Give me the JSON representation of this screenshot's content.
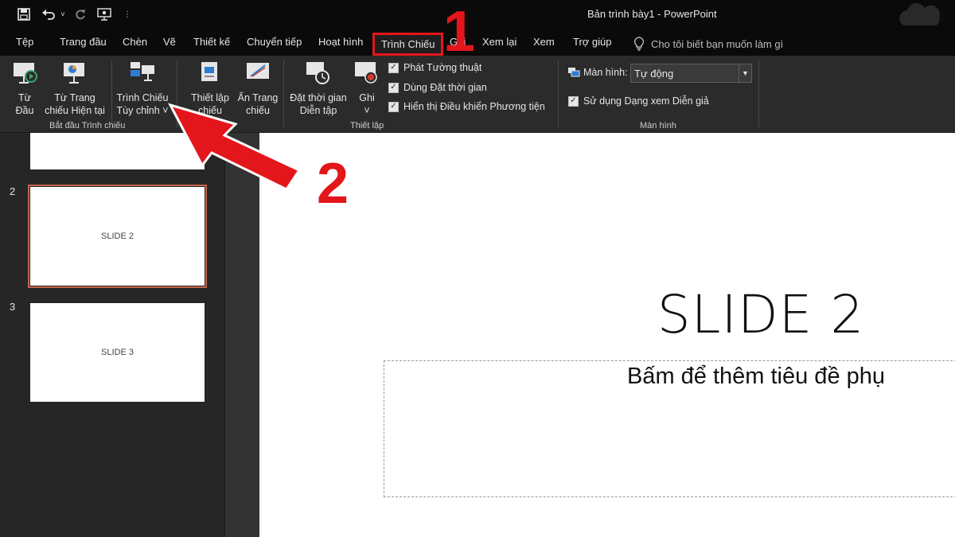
{
  "titlebar": {
    "doc_title": "Bản trình bày1  -  PowerPoint"
  },
  "menu": {
    "tabs": [
      "Tệp",
      "Trang đầu",
      "Chèn",
      "Vẽ",
      "Thiết kế",
      "Chuyển tiếp",
      "Hoạt hình",
      "Trình Chiếu",
      "Ghi",
      "Xem lại",
      "Xem",
      "Trợ giúp"
    ],
    "active_tab": "Trình Chiếu",
    "tell_me": "Cho tôi biết bạn muốn làm gì"
  },
  "ribbon": {
    "start_group": {
      "from_start": [
        "Từ",
        "Đầu"
      ],
      "from_current": [
        "Từ Trang",
        "chiếu Hiện tại"
      ],
      "custom_show": [
        "Trình Chiếu",
        "Tùy chỉnh ˅"
      ],
      "label": "Bắt đầu Trình chiếu"
    },
    "setup_group": {
      "setup": [
        "Thiết lập",
        "chiếu"
      ],
      "hide_slide": [
        "Ẩn Trang",
        "chiếu"
      ],
      "rehearse": [
        "Đặt thời gian",
        "Diễn tập"
      ],
      "record": [
        "Ghi",
        "˅"
      ],
      "checks": [
        "Phát Tường thuật",
        "Dùng Đặt thời gian",
        "Hiển thị Điều khiển Phương tiện"
      ],
      "label": "Thiết lập"
    },
    "monitor_group": {
      "monitor_label": "Màn hình:",
      "monitor_value": "Tự động",
      "presenter_view": "Sử dụng Dạng xem Diễn giả",
      "label": "Màn hình"
    }
  },
  "thumbnails": [
    {
      "num": "2",
      "text": "SLIDE 2"
    },
    {
      "num": "3",
      "text": "SLIDE 3"
    }
  ],
  "slide": {
    "title": "SLIDE 2",
    "subtitle": "Bấm để thêm tiêu đề phụ"
  },
  "annotations": {
    "step1": "1",
    "step2": "2"
  },
  "colors": {
    "annotation": "#e3161b",
    "selection": "#c2654b"
  }
}
